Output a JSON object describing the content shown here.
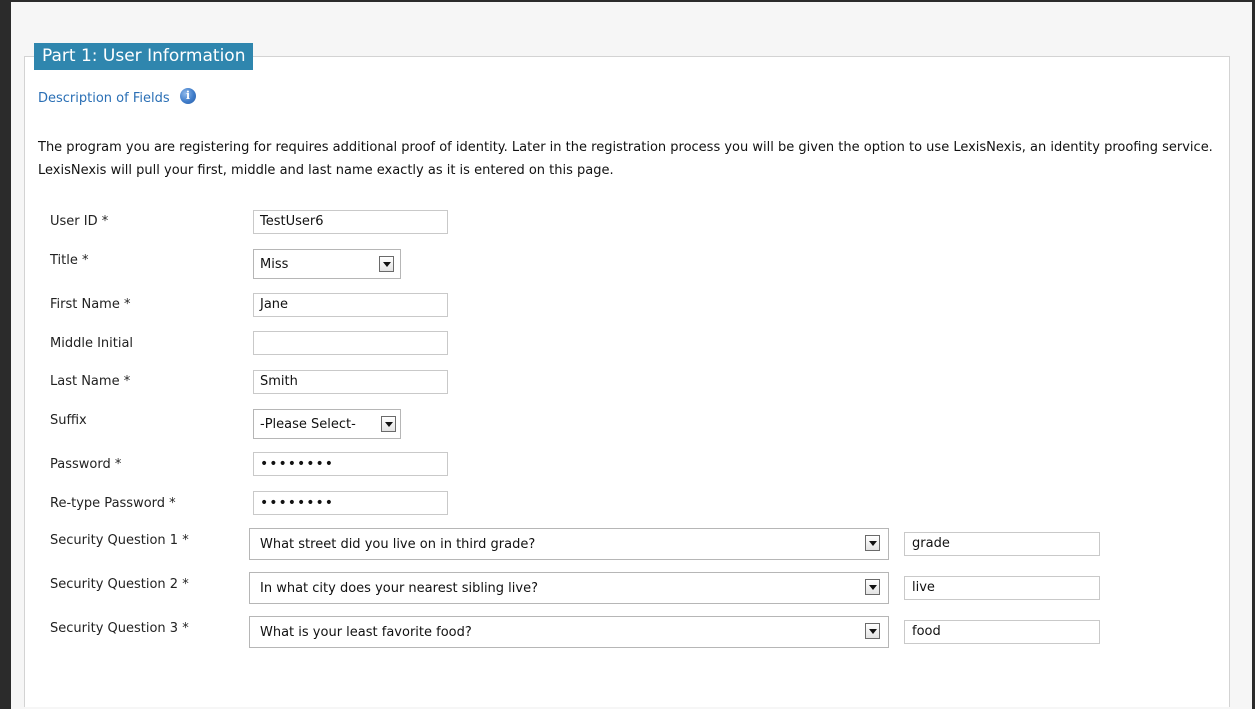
{
  "section": {
    "legend": "Part 1: User Information",
    "description_link": "Description of Fields",
    "info_icon": "i",
    "intro_text": "The program you are registering for requires additional proof of identity. Later in the registration process you will be given the option to use LexisNexis, an identity proofing service. LexisNexis will pull your first, middle and last name exactly as it is entered on this page."
  },
  "fields": {
    "user_id": {
      "label": "User ID *",
      "value": "TestUser6"
    },
    "title": {
      "label": "Title *",
      "value": "Miss"
    },
    "first_name": {
      "label": "First Name *",
      "value": "Jane"
    },
    "middle_initial": {
      "label": "Middle Initial",
      "value": ""
    },
    "last_name": {
      "label": "Last Name *",
      "value": "Smith"
    },
    "suffix": {
      "label": "Suffix",
      "value": "-Please Select-"
    },
    "password": {
      "label": "Password *",
      "value": "••••••••"
    },
    "retype_password": {
      "label": "Re-type Password *",
      "value": "••••••••"
    },
    "security_q1": {
      "label": "Security Question 1 *",
      "question": "What street did you live on in third grade?",
      "answer": "grade"
    },
    "security_q2": {
      "label": "Security Question 2 *",
      "question": "In what city does your nearest sibling live?",
      "answer": "live"
    },
    "security_q3": {
      "label": "Security Question 3 *",
      "question": "What is your least favorite food?",
      "answer": "food"
    }
  },
  "colors": {
    "legend_bg": "#2f86ae",
    "link": "#2a6fb5",
    "page_frame": "#2b2b2b"
  }
}
